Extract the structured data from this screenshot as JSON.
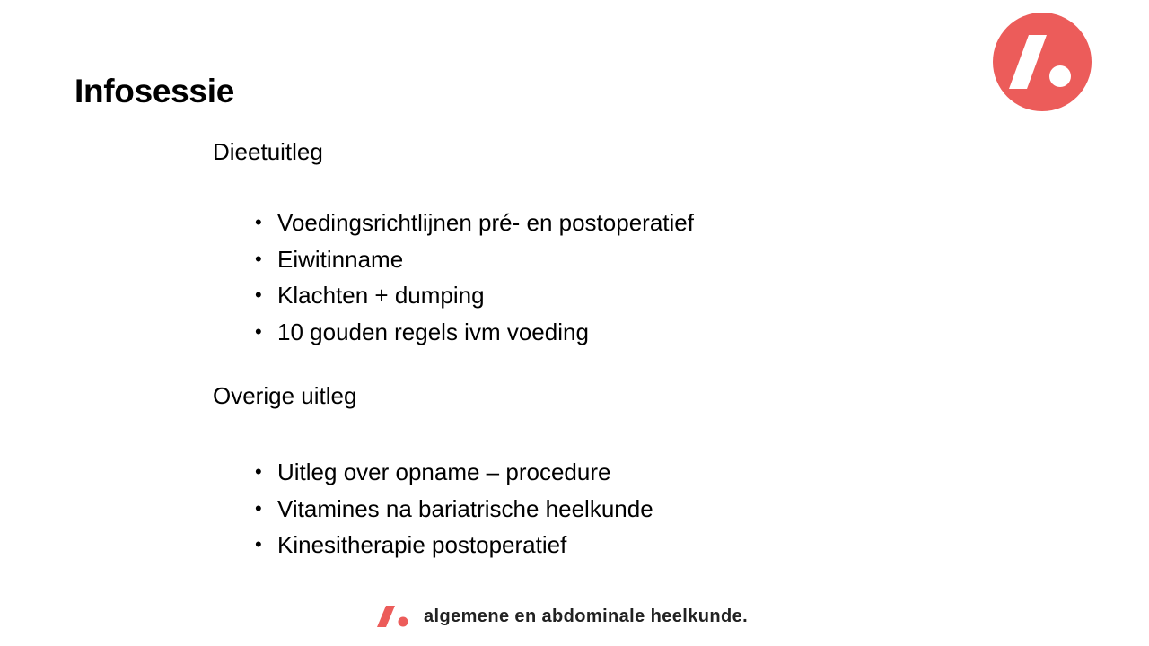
{
  "slide": {
    "title": "Infosessie"
  },
  "brand": {
    "accent_color": "#ec5c5a",
    "logo_icon": "slash-dot-logo-icon",
    "footer_text": "algemene en abdominale  heelkunde."
  },
  "sections": [
    {
      "heading": "Dieetuitleg",
      "items": [
        "Voedingsrichtlijnen pré- en postoperatief",
        "Eiwitinname",
        "Klachten + dumping",
        "10 gouden regels ivm voeding"
      ]
    },
    {
      "heading": "Overige uitleg",
      "items": [
        "Uitleg over opname – procedure",
        "Vitamines na bariatrische heelkunde",
        "Kinesitherapie postoperatief"
      ]
    }
  ]
}
